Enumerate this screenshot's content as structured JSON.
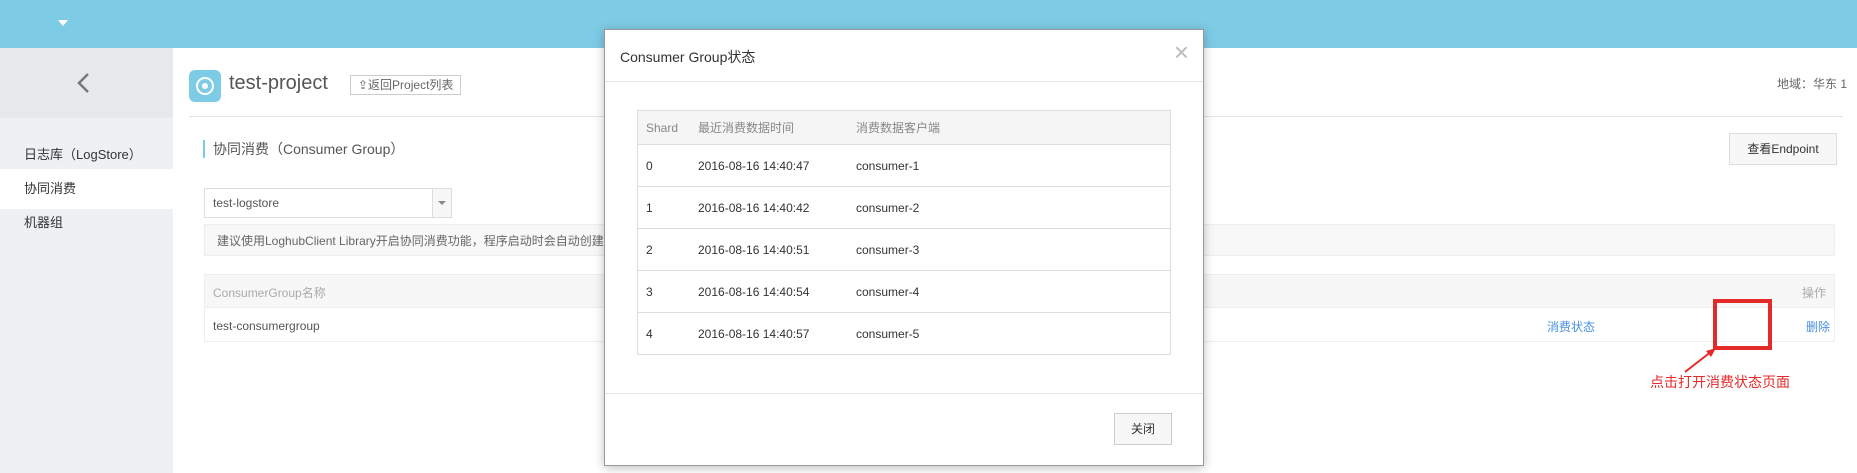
{
  "sidebar": {
    "items": [
      {
        "label": "日志库（LogStore）"
      },
      {
        "label": "协同消费"
      },
      {
        "label": "机器组"
      }
    ]
  },
  "header": {
    "project_title": "test-project",
    "back_label": "⇪返回Project列表",
    "region_label": "地域：华东 1"
  },
  "main": {
    "section_title": "协同消费（Consumer Group）",
    "endpoint_button": "查看Endpoint",
    "logstore_select": "test-logstore",
    "tip": "建议使用LoghubClient Library开启协同消费功能，程序启动时会自动创建",
    "group_table": {
      "col_name": "ConsumerGroup名称",
      "col_action": "操作",
      "rows": [
        {
          "name": "test-consumergroup",
          "status_link": "消费状态",
          "delete_link": "删除"
        }
      ]
    }
  },
  "annotation": {
    "text": "点击打开消费状态页面",
    "color": "#e52a2a"
  },
  "modal": {
    "title": "Consumer Group状态",
    "close_icon": "×",
    "columns": [
      "Shard",
      "最近消费数据时间",
      "消费数据客户端"
    ],
    "rows": [
      {
        "shard": "0",
        "time": "2016-08-16 14:40:47",
        "client": "consumer-1"
      },
      {
        "shard": "1",
        "time": "2016-08-16 14:40:42",
        "client": "consumer-2"
      },
      {
        "shard": "2",
        "time": "2016-08-16 14:40:51",
        "client": "consumer-3"
      },
      {
        "shard": "3",
        "time": "2016-08-16 14:40:54",
        "client": "consumer-4"
      },
      {
        "shard": "4",
        "time": "2016-08-16 14:40:57",
        "client": "consumer-5"
      }
    ],
    "close_button": "关闭"
  },
  "colors": {
    "topbar": "#7ecbe5",
    "link": "#4a90e2",
    "sidebar_bg": "#eef1f3"
  }
}
